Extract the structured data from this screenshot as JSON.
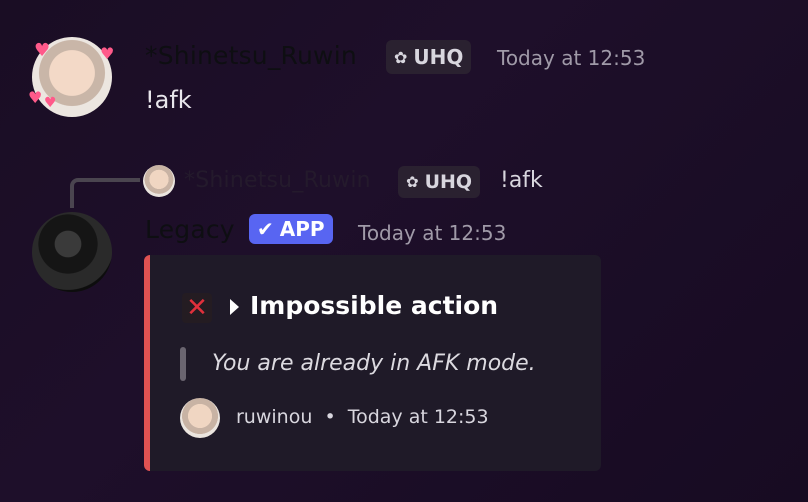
{
  "message1": {
    "username": "*Shinetsu_Ruwin",
    "badge": "UHQ",
    "timestamp": "Today at 12:53",
    "content": "!afk"
  },
  "reply": {
    "username": "*Shinetsu_Ruwin",
    "badge": "UHQ",
    "content": "!afk"
  },
  "message2": {
    "username": "Legacy",
    "badge": "APP",
    "timestamp": "Today at 12:53"
  },
  "embed": {
    "accent_color": "#e05252",
    "icon": "cross-mark-icon",
    "title": "Impossible action",
    "description": "You are already in AFK mode.",
    "footer_user": "ruwinou",
    "footer_separator": "•",
    "footer_time": "Today at 12:53"
  }
}
